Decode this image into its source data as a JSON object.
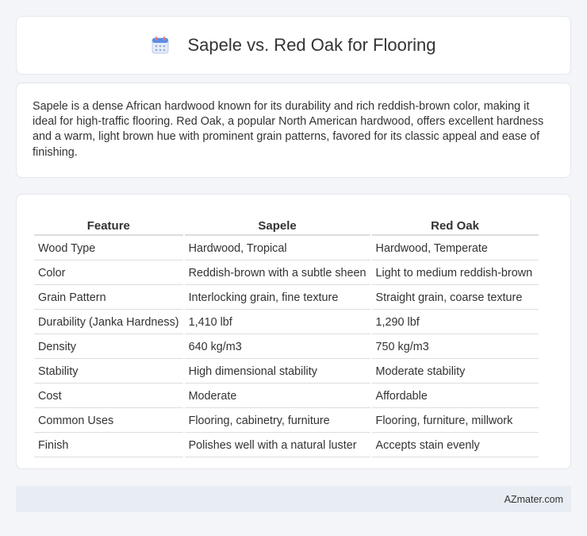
{
  "header": {
    "title": "Sapele vs. Red Oak for Flooring",
    "icon": "calendar-icon",
    "icon_color": "#5b8de8"
  },
  "intro": {
    "text": "Sapele is a dense African hardwood known for its durability and rich reddish-brown color, making it ideal for high-traffic flooring. Red Oak, a popular North American hardwood, offers excellent hardness and a warm, light brown hue with prominent grain patterns, favored for its classic appeal and ease of finishing."
  },
  "table": {
    "columns": [
      "Feature",
      "Sapele",
      "Red Oak"
    ],
    "rows": [
      [
        "Wood Type",
        "Hardwood, Tropical",
        "Hardwood, Temperate"
      ],
      [
        "Color",
        "Reddish-brown with a subtle sheen",
        "Light to medium reddish-brown"
      ],
      [
        "Grain Pattern",
        "Interlocking grain, fine texture",
        "Straight grain, coarse texture"
      ],
      [
        "Durability (Janka Hardness)",
        "1,410 lbf",
        "1,290 lbf"
      ],
      [
        "Density",
        "640 kg/m3",
        "750 kg/m3"
      ],
      [
        "Stability",
        "High dimensional stability",
        "Moderate stability"
      ],
      [
        "Cost",
        "Moderate",
        "Affordable"
      ],
      [
        "Common Uses",
        "Flooring, cabinetry, furniture",
        "Flooring, furniture, millwork"
      ],
      [
        "Finish",
        "Polishes well with a natural luster",
        "Accepts stain evenly"
      ]
    ]
  },
  "footer": {
    "site": "AZmater.com"
  }
}
